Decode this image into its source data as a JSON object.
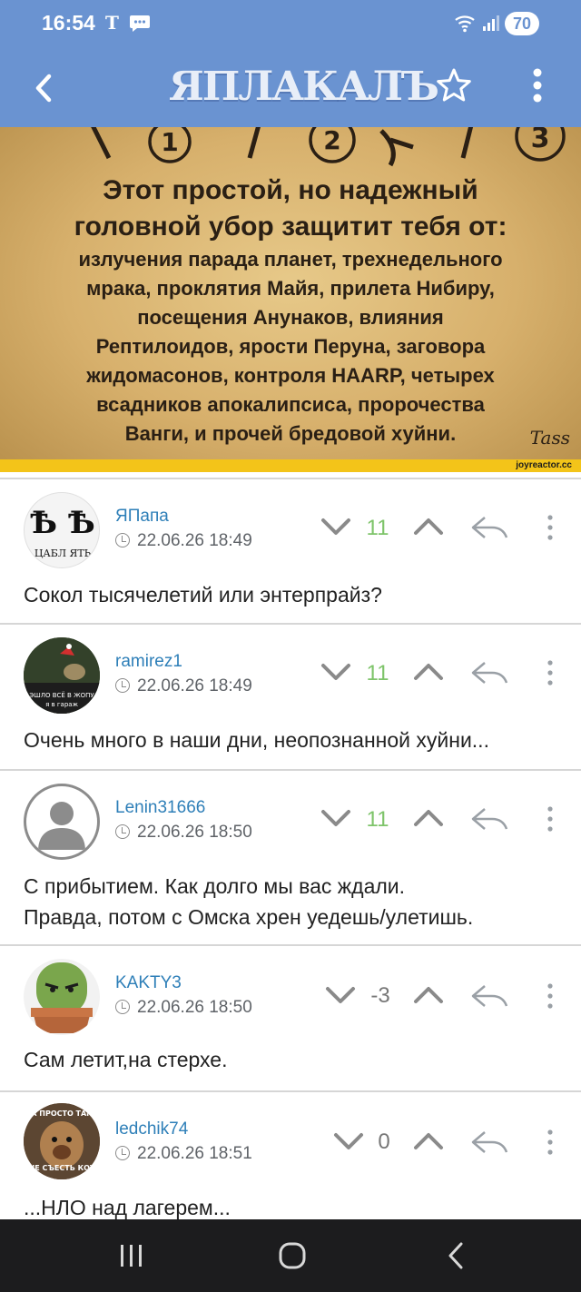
{
  "status_bar": {
    "time": "16:54",
    "carrier_icon": "T",
    "battery": "70"
  },
  "app_bar": {
    "logo": "ЯПЛАКАЛЪ"
  },
  "post_image": {
    "numbers": [
      "1",
      "2",
      "3"
    ],
    "headline_1": "Этот простой, но надежный",
    "headline_2": "головной убор защитит тебя от:",
    "body_lines": [
      "излучения парада планет, трехнедельного",
      "мрака, проклятия Майя, прилета Нибиру,",
      "посещения Анунаков, влияния",
      "Рептилоидов, ярости Перуна, заговора",
      "жидомасонов, контроля HAARP, четырех",
      "всадников апокалипсиса, пророчества",
      "Ванги, и прочей бредовой хуйни."
    ],
    "signature": "Tass",
    "credit": "joyreactor.cc"
  },
  "comments": [
    {
      "username": "ЯПапа",
      "date": "22.06.26 18:49",
      "score": "11",
      "score_color": "#7ec46a",
      "text": "Сокол тысячелетий или энтерпрайз?",
      "avatar_text_1": "Ѣ Ѣ",
      "avatar_text_2": "ЦАБЛ ЯТЬ"
    },
    {
      "username": "ramirez1",
      "date": "22.06.26 18:49",
      "score": "11",
      "score_color": "#7ec46a",
      "text": "Очень много в наши дни, неопознанной хуйни...",
      "avatar_text_1": "ЭШЛО ВСЁ В ЖОПУ",
      "avatar_text_2": "я в гараж"
    },
    {
      "username": "Lenin31666",
      "date": "22.06.26 18:50",
      "score": "11",
      "score_color": "#7ec46a",
      "text_line_1": "С прибытием. Как долго мы вас ждали.",
      "text_line_2": "Правда, потом с Омска хрен уедешь/улетишь."
    },
    {
      "username": "KAKTY3",
      "date": "22.06.26 18:50",
      "score": "-3",
      "score_color": "#777777",
      "text": "Сам летит,на стерхе."
    },
    {
      "username": "ledchik74",
      "date": "22.06.26 18:51",
      "score": "0",
      "score_color": "#777777",
      "text": "...НЛО над лагерем...",
      "avatar_text_1": "А ПРОСТО ТАК",
      "avatar_text_2": "НЕ СЪЕСТЬ КОТ"
    }
  ],
  "icons": {
    "back": "chevron-left-icon",
    "favorite": "star-icon",
    "menu": "more-vertical-icon",
    "vote_down": "chevron-down-icon",
    "vote_up": "chevron-up-icon",
    "reply": "reply-icon",
    "comment_menu": "kebab-icon",
    "nav_recents": "recents-icon",
    "nav_home": "home-icon",
    "nav_back": "nav-back-icon"
  },
  "colors": {
    "brand_blue": "#6a93d1",
    "username_link": "#2e7fb8",
    "positive_score": "#7ec46a",
    "credit_bar": "#f3c419"
  }
}
